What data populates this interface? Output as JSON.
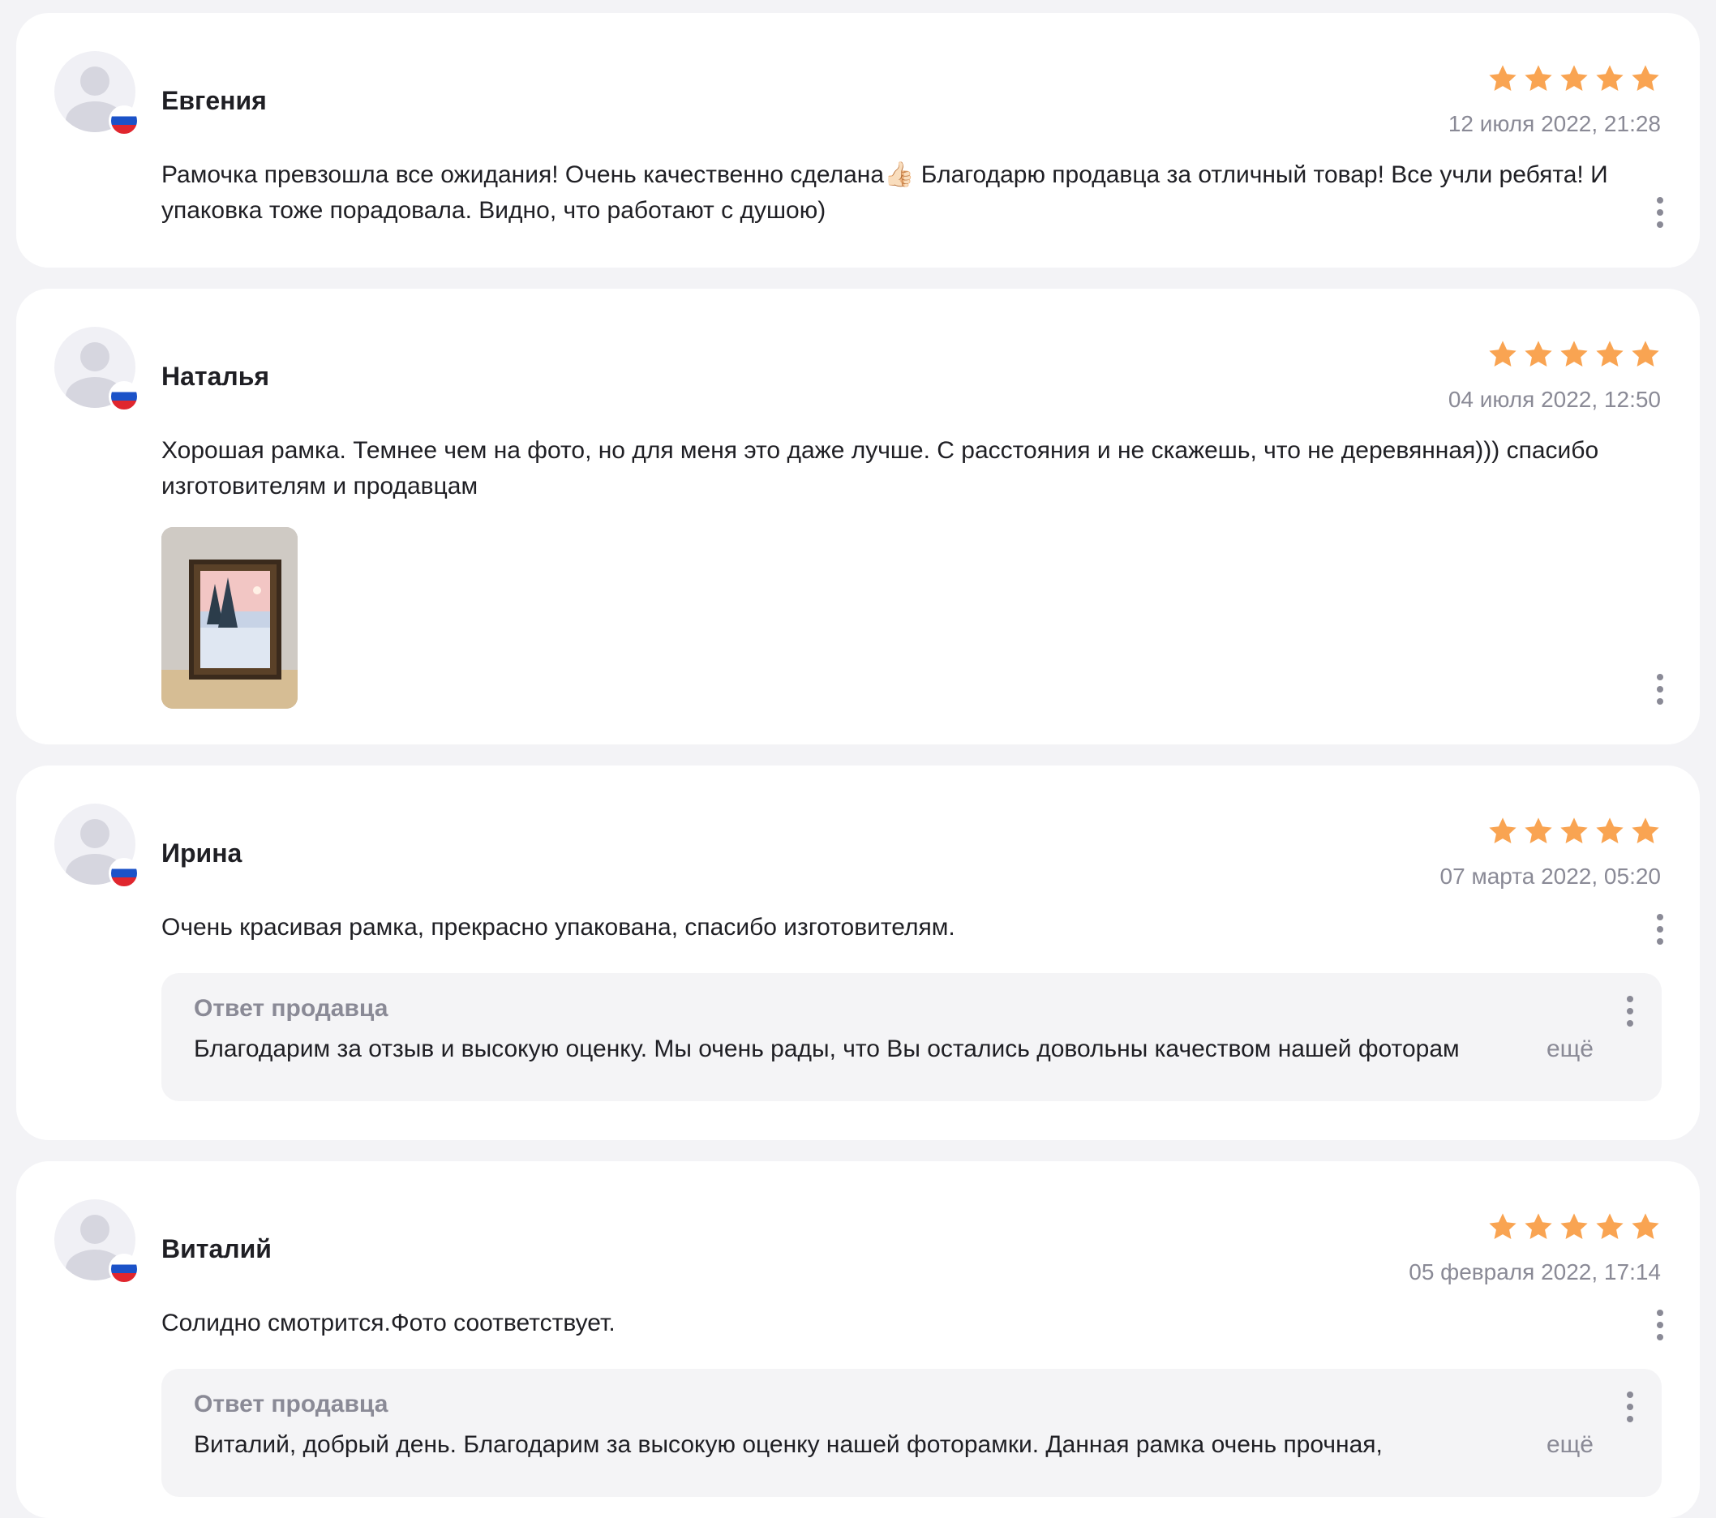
{
  "accent_star_color": "#f9a452",
  "reviews": [
    {
      "author": "Евгения",
      "rating": 5,
      "date": "12 июля 2022, 21:28",
      "text": "Рамочка превзошла все ожидания! Очень качественно сделана👍🏻 Благодарю продавца за отличный товар! Все учли ребята! И упаковка тоже порадовала. Видно, что работают с душою)"
    },
    {
      "author": "Наталья",
      "rating": 5,
      "date": "04 июля 2022, 12:50",
      "text": "Хорошая рамка. Темнее чем на фото, но для меня это даже лучше. С расстояния и не скажешь, что не деревянная))) спасибо изготовителям и продавцам",
      "photo_icon": "framed-winter-painting-photo"
    },
    {
      "author": "Ирина",
      "rating": 5,
      "date": "07 марта 2022, 05:20",
      "text": "Очень красивая рамка, прекрасно упакована, спасибо изготовителям.",
      "reply": {
        "title": "Ответ продавца",
        "text": "Благодарим за отзыв и высокую оценку. Мы очень рады, что Вы остались довольны качеством нашей фоторам",
        "more_label": "ещё"
      }
    },
    {
      "author": "Виталий",
      "rating": 5,
      "date": "05 февраля 2022, 17:14",
      "text": "Солидно смотрится.Фото соответствует.",
      "reply": {
        "title": "Ответ продавца",
        "text": "Виталий, добрый день. Благодарим за высокую оценку нашей фоторамки. Данная рамка очень прочная,",
        "more_label": "ещё"
      }
    }
  ]
}
